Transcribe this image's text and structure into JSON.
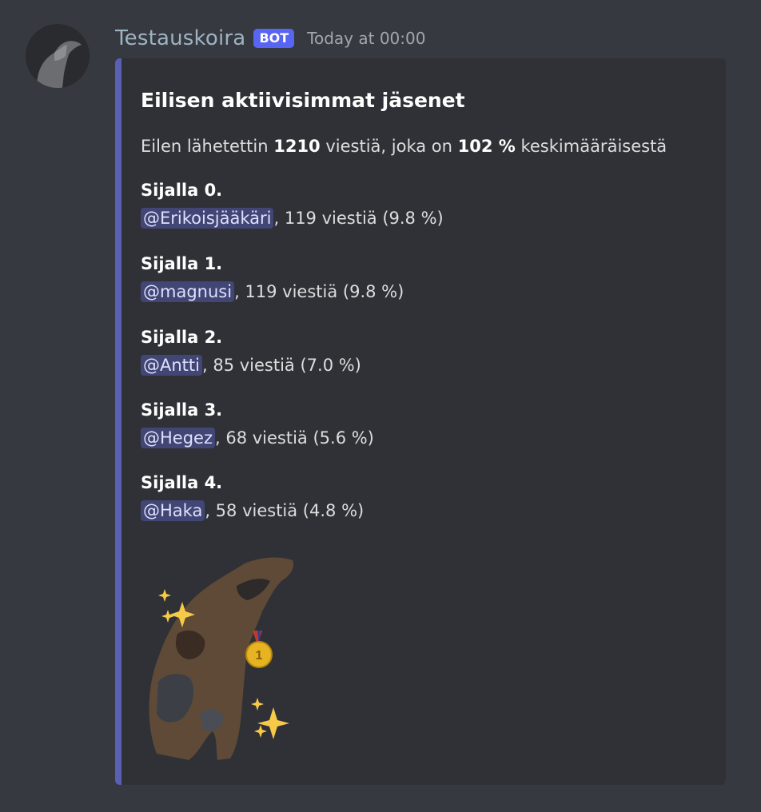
{
  "message": {
    "author": "Testauskoira",
    "badge": "BOT",
    "timestamp": "Today at 00:00"
  },
  "embed": {
    "title": "Eilisen aktiivisimmat jäsenet",
    "description": {
      "prefix": "Eilen lähetettin ",
      "count": "1210",
      "middle": " viestiä, joka on ",
      "percent": "102 %",
      "suffix": " keskimääräisestä"
    },
    "fields": [
      {
        "name": "Sijalla 0.",
        "mention": "@Erikoisjääkäri",
        "value": ", 119 viestiä (9.8 %)"
      },
      {
        "name": "Sijalla 1.",
        "mention": "@magnusi",
        "value": ", 119 viestiä (9.8 %)"
      },
      {
        "name": "Sijalla 2.",
        "mention": "@Antti",
        "value": ", 85 viestiä (7.0 %)"
      },
      {
        "name": "Sijalla 3.",
        "mention": "@Hegez",
        "value": ", 68 viestiä (5.6 %)"
      },
      {
        "name": "Sijalla 4.",
        "mention": "@Haka",
        "value": ", 58 viestiä (4.8 %)"
      }
    ],
    "accent_color": "#5a5fb4",
    "image_icon": "dog-with-medal-icon"
  }
}
